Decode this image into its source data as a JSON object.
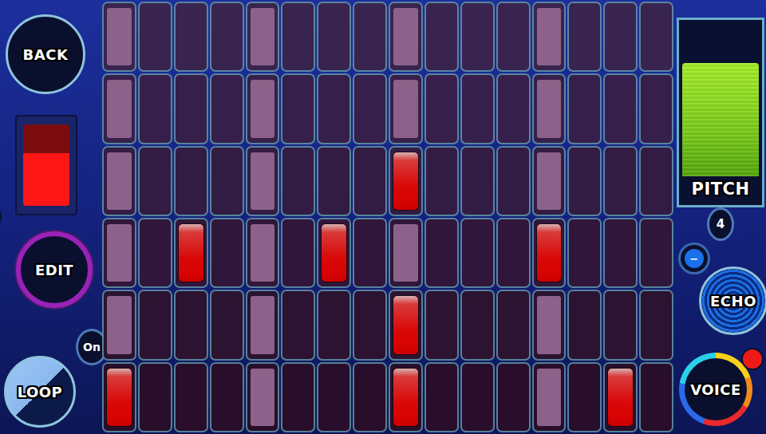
{
  "back_button": {
    "label": "BACK"
  },
  "indicator": {
    "level": 0.65
  },
  "edit_button": {
    "label": "EDIT"
  },
  "loop_button": {
    "label": "LOOP",
    "badge": "On",
    "on": true
  },
  "grid": {
    "accent_columns": [
      {
        "accent": true
      },
      {
        "accent": false
      },
      {
        "accent": false
      },
      {
        "accent": false
      },
      {
        "accent": true
      },
      {
        "accent": false
      },
      {
        "accent": false
      },
      {
        "accent": false
      },
      {
        "accent": true
      },
      {
        "accent": false
      },
      {
        "accent": false
      },
      {
        "accent": false
      },
      {
        "accent": true
      },
      {
        "accent": false
      },
      {
        "accent": false
      },
      {
        "accent": false
      }
    ],
    "rows": [
      {
        "cells": [
          {
            "on": false
          },
          {
            "on": false
          },
          {
            "on": false
          },
          {
            "on": false
          },
          {
            "on": false
          },
          {
            "on": false
          },
          {
            "on": false
          },
          {
            "on": false
          },
          {
            "on": false
          },
          {
            "on": false
          },
          {
            "on": false
          },
          {
            "on": false
          },
          {
            "on": false
          },
          {
            "on": false
          },
          {
            "on": false
          },
          {
            "on": false
          }
        ]
      },
      {
        "cells": [
          {
            "on": false
          },
          {
            "on": false
          },
          {
            "on": false
          },
          {
            "on": false
          },
          {
            "on": false
          },
          {
            "on": false
          },
          {
            "on": false
          },
          {
            "on": false
          },
          {
            "on": false
          },
          {
            "on": false
          },
          {
            "on": false
          },
          {
            "on": false
          },
          {
            "on": false
          },
          {
            "on": false
          },
          {
            "on": false
          },
          {
            "on": false
          }
        ]
      },
      {
        "cells": [
          {
            "on": false
          },
          {
            "on": false
          },
          {
            "on": false
          },
          {
            "on": false
          },
          {
            "on": false
          },
          {
            "on": false
          },
          {
            "on": false
          },
          {
            "on": false
          },
          {
            "on": true
          },
          {
            "on": false
          },
          {
            "on": false
          },
          {
            "on": false
          },
          {
            "on": false
          },
          {
            "on": false
          },
          {
            "on": false
          },
          {
            "on": false
          }
        ]
      },
      {
        "cells": [
          {
            "on": false
          },
          {
            "on": false
          },
          {
            "on": true
          },
          {
            "on": false
          },
          {
            "on": false
          },
          {
            "on": false
          },
          {
            "on": true
          },
          {
            "on": false
          },
          {
            "on": false
          },
          {
            "on": false
          },
          {
            "on": false
          },
          {
            "on": false
          },
          {
            "on": true
          },
          {
            "on": false
          },
          {
            "on": false
          },
          {
            "on": false
          }
        ]
      },
      {
        "cells": [
          {
            "on": false
          },
          {
            "on": false
          },
          {
            "on": false
          },
          {
            "on": false
          },
          {
            "on": false
          },
          {
            "on": false
          },
          {
            "on": false
          },
          {
            "on": false
          },
          {
            "on": true
          },
          {
            "on": false
          },
          {
            "on": false
          },
          {
            "on": false
          },
          {
            "on": false
          },
          {
            "on": false
          },
          {
            "on": false
          },
          {
            "on": false
          }
        ]
      },
      {
        "cells": [
          {
            "on": true
          },
          {
            "on": false
          },
          {
            "on": false
          },
          {
            "on": false
          },
          {
            "on": false
          },
          {
            "on": false
          },
          {
            "on": false
          },
          {
            "on": false
          },
          {
            "on": true
          },
          {
            "on": false
          },
          {
            "on": false
          },
          {
            "on": false
          },
          {
            "on": false
          },
          {
            "on": false
          },
          {
            "on": true
          },
          {
            "on": false
          }
        ]
      }
    ]
  },
  "pitch": {
    "label": "PITCH",
    "level": 0.75,
    "value": "4"
  },
  "echo_button": {
    "label": "ECHO",
    "badge": "−"
  },
  "voice_button": {
    "label": "VOICE"
  }
}
